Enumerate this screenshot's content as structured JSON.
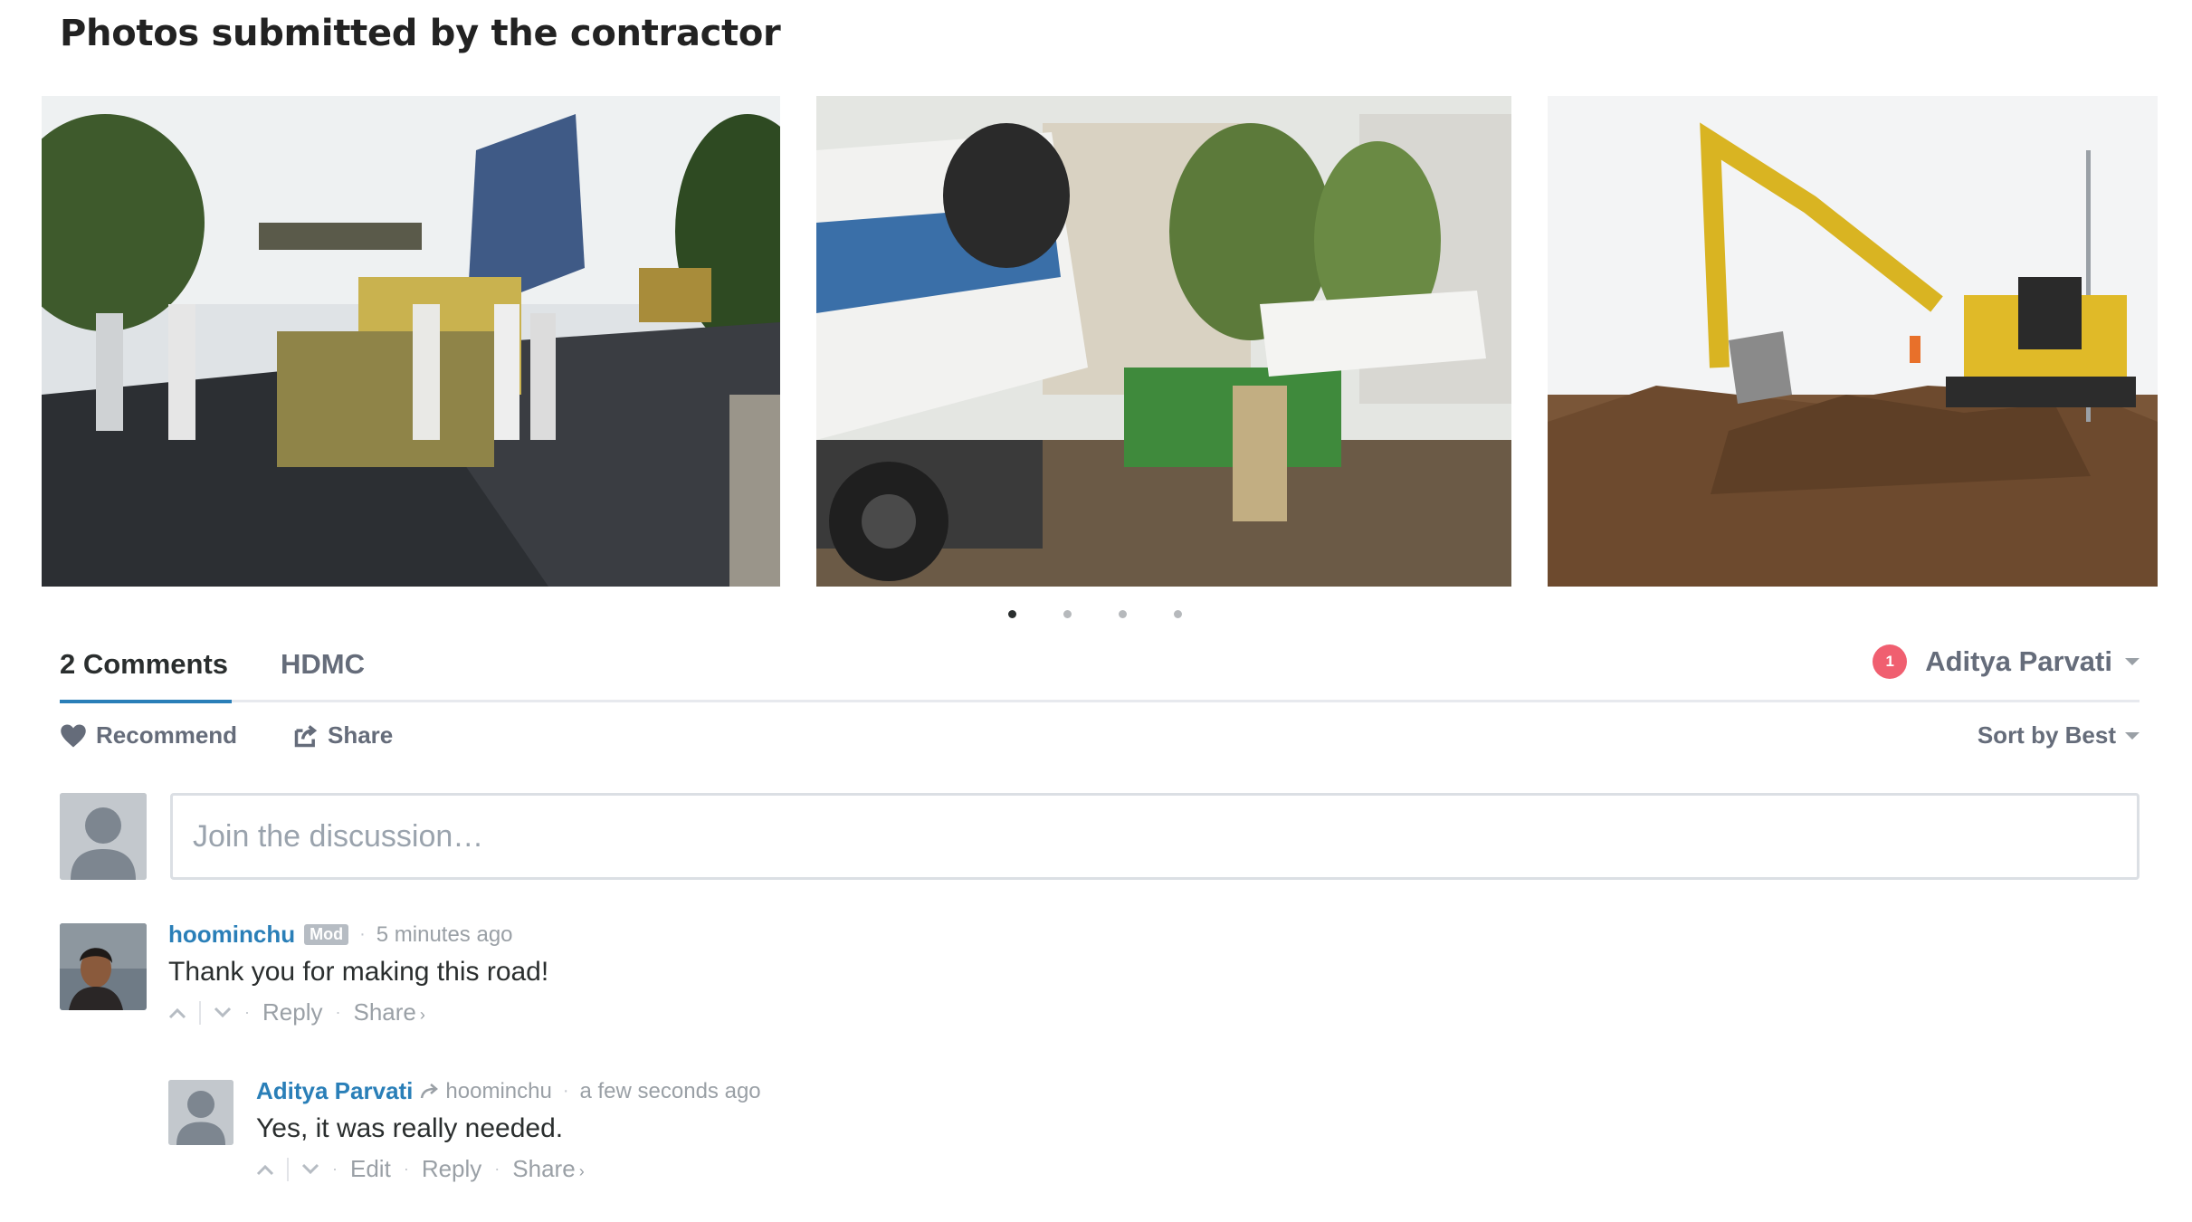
{
  "page": {
    "title": "Photos submitted by the contractor"
  },
  "gallery": {
    "photos": [
      {
        "subject": "road paving machine and workers"
      },
      {
        "subject": "concrete mixer truck and pump"
      },
      {
        "subject": "excavator on dirt mound"
      }
    ],
    "pages": 4,
    "active_page": 1
  },
  "tabs": {
    "comments_label": "2 Comments",
    "community_label": "HDMC"
  },
  "user": {
    "name": "Aditya Parvati",
    "notifications": "1"
  },
  "actions": {
    "recommend": "Recommend",
    "share": "Share",
    "sort": "Sort by Best"
  },
  "composer": {
    "placeholder": "Join the discussion…"
  },
  "comments": [
    {
      "author": "hoominchu",
      "badge": "Mod",
      "time": "5 minutes ago",
      "text": "Thank you for making this road!",
      "actions": {
        "reply": "Reply",
        "share": "Share"
      }
    },
    {
      "author": "Aditya Parvati",
      "reply_to": "hoominchu",
      "time": "a few seconds ago",
      "text": "Yes, it was really needed.",
      "actions": {
        "edit": "Edit",
        "reply": "Reply",
        "share": "Share"
      }
    }
  ],
  "colors": {
    "link": "#2a7fb8",
    "notification": "#f05f70",
    "muted": "#656c7a"
  }
}
